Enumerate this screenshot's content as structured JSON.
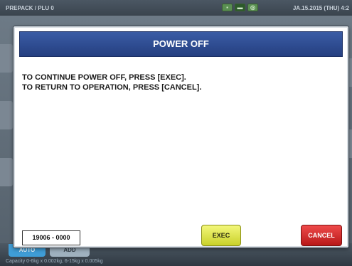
{
  "topbar": {
    "breadcrumb": "PREPACK / PLU 0",
    "datetime": "JA.15.2015 (THU)  4:2"
  },
  "bottom": {
    "tabs": [
      {
        "label": "AUTO"
      },
      {
        "label": "ADD"
      }
    ],
    "capacity": "Capacity 0-6kg x 0.002kg, 6-15kg x 0.005kg"
  },
  "dialog": {
    "title": "POWER OFF",
    "message_lines": [
      "TO CONTINUE POWER OFF, PRESS [EXEC].",
      "TO RETURN TO OPERATION, PRESS [CANCEL]."
    ],
    "code": "19006 - 0000",
    "exec_label": "EXEC",
    "cancel_label": "CANCEL"
  },
  "colors": {
    "header_blue": "#2f4d93",
    "exec_yellow": "#e4ea4a",
    "cancel_red": "#d42a2a"
  }
}
